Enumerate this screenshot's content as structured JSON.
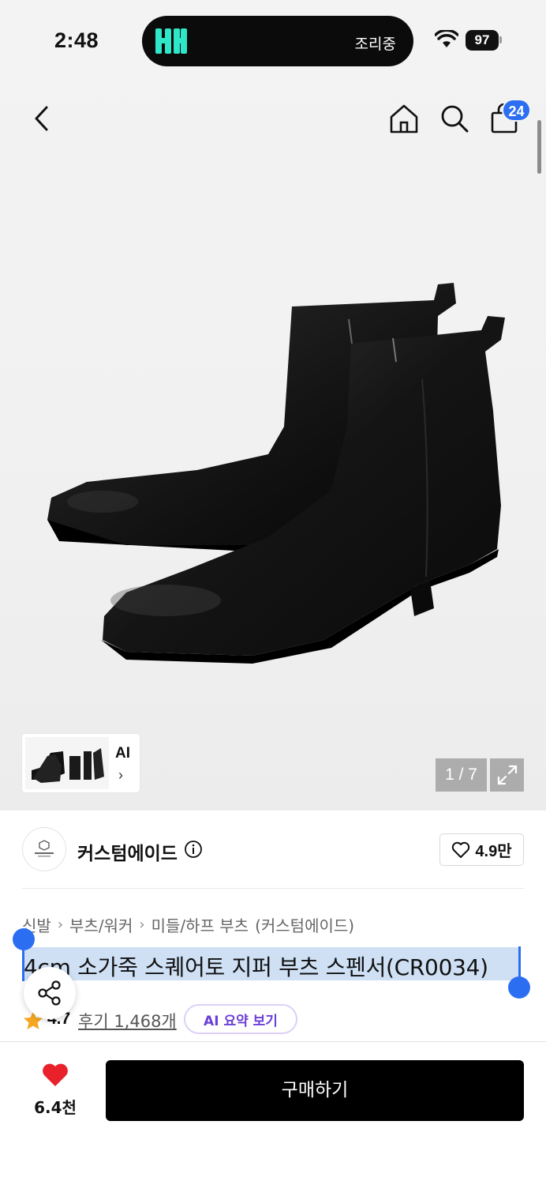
{
  "status_bar": {
    "time": "2:48",
    "island_text": "조리중",
    "battery": "97"
  },
  "header": {
    "cart_count": "24"
  },
  "gallery": {
    "counter": "1 / 7",
    "thumb_label": "AI",
    "thumb_chevron": "›"
  },
  "brand": {
    "name": "커스텀에이드",
    "likes": "4.9만"
  },
  "breadcrumb": [
    "신발",
    "부츠/워커",
    "미들/하프 부츠",
    "(커스텀에이드)"
  ],
  "breadcrumb_sep": "›",
  "product": {
    "title": "4cm 소가죽 스퀘어토 지퍼 부츠 스펜서(CR0034)",
    "rating": "4.7",
    "reviews": "후기 1,468개",
    "ai_summary": "AI 요약 보기"
  },
  "bottom_bar": {
    "like_count": "6.4천",
    "buy_label": "구매하기"
  },
  "colors": {
    "accent_blue": "#2b6ef2",
    "heart_red": "#e8212b",
    "star_orange": "#f5a623",
    "ai_purple": "#6b3fd6",
    "island_logo": "#2ee6c8"
  }
}
